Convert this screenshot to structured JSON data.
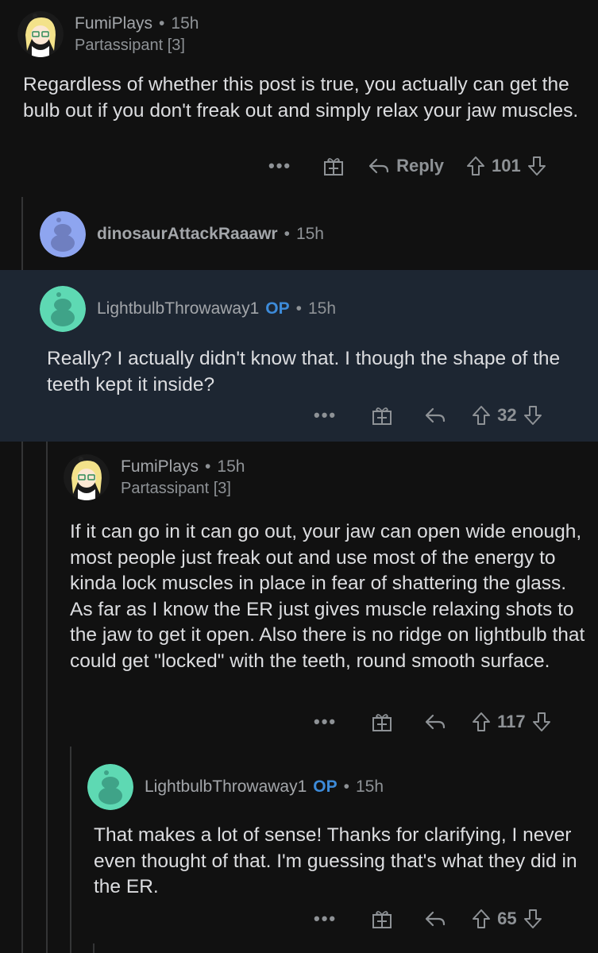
{
  "comments": [
    {
      "username": "FumiPlays",
      "time": "15h",
      "flair": "Partassipant [3]",
      "body": "Regardless of whether this post is true, you actually can get the bulb out if you don't freak out and simply relax your jaw muscles.",
      "reply_label": "Reply",
      "votes": "101",
      "more": "•••"
    },
    {
      "username": "dinosaurAttackRaaawr",
      "time": "15h"
    },
    {
      "username": "LightbulbThrowaway1",
      "op_badge": "OP",
      "time": "15h",
      "body": "Really? I actually didn't know that. I though the shape of the teeth kept it inside?",
      "votes": "32",
      "more": "•••"
    },
    {
      "username": "FumiPlays",
      "time": "15h",
      "flair": "Partassipant [3]",
      "body": "If it can go in it can go out, your jaw can open wide enough, most people just freak out and use most of the energy to kinda lock muscles in place in fear of shattering the glass. As far as I know the ER just gives muscle relaxing shots to the jaw to get it open. Also there is no ridge on lightbulb that could get \"locked\" with the teeth, round smooth surface.",
      "votes": "117",
      "more": "•••"
    },
    {
      "username": "LightbulbThrowaway1",
      "op_badge": "OP",
      "time": "15h",
      "body": "That makes a lot of sense! Thanks for clarifying, I never even thought of that. I'm guessing that's what they did in the ER.",
      "votes": "65",
      "more": "•••"
    }
  ],
  "colors": {
    "background": "#111111",
    "highlight": "#1d2632",
    "op": "#3d8bd9",
    "thread_line": "#343536",
    "avatar_teal": "#5ed9b3",
    "avatar_blue": "#8ea5f0"
  },
  "icons": [
    "more-icon",
    "award-icon",
    "reply-icon",
    "upvote-icon",
    "downvote-icon"
  ]
}
